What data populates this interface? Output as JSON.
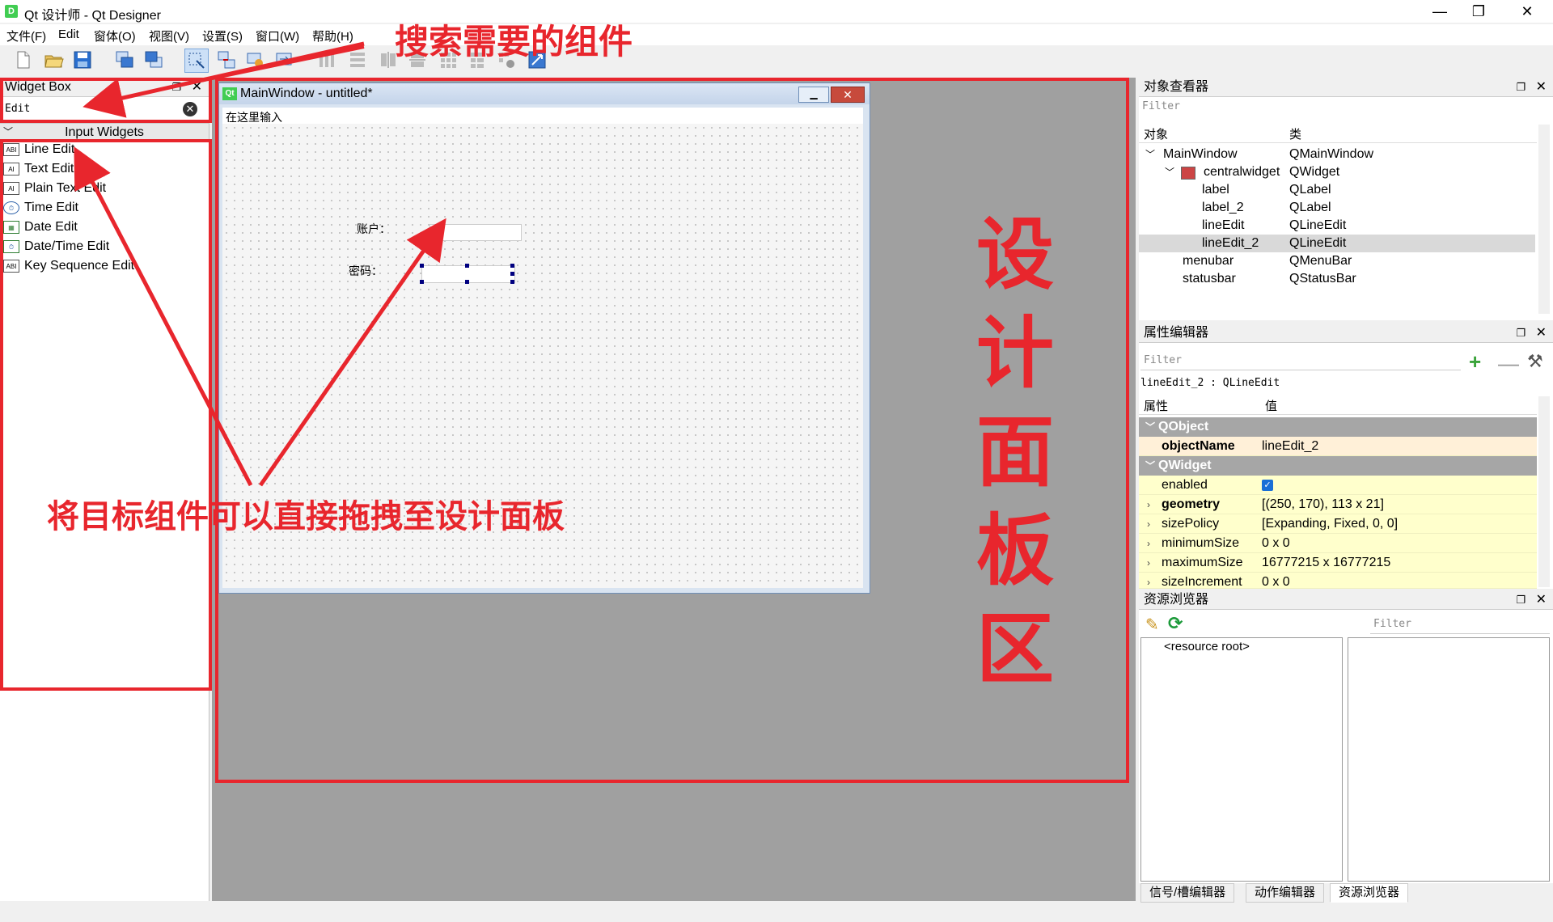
{
  "window": {
    "title": "Qt 设计师 - Qt Designer",
    "app_icon": "D",
    "min": "—",
    "max": "❐",
    "close": "✕"
  },
  "menubar": [
    "文件(F)",
    "Edit",
    "窗体(O)",
    "视图(V)",
    "设置(S)",
    "窗口(W)",
    "帮助(H)"
  ],
  "toolbar_icons": [
    "new-icon",
    "open-icon",
    "save-icon",
    "send-back-icon",
    "bring-front-icon",
    "edit-widgets-icon",
    "edit-signals-icon",
    "edit-buddies-icon",
    "edit-tab-order-icon",
    "layout-horizontal-icon",
    "layout-vertical-icon",
    "layout-splitter-h-icon",
    "layout-splitter-v-icon",
    "layout-grid-icon",
    "layout-form-icon",
    "break-layout-icon",
    "adjust-size-icon"
  ],
  "widget_box": {
    "title": "Widget Box",
    "search_value": "Edit",
    "category": "Input Widgets",
    "items": [
      "Line Edit",
      "Text Edit",
      "Plain Text Edit",
      "Time Edit",
      "Date Edit",
      "Date/Time Edit",
      "Key Sequence Edit"
    ],
    "item_icon_text": [
      "ABI",
      "AI",
      "AI",
      "⏱",
      "▦",
      "⏱",
      "ABI"
    ]
  },
  "form": {
    "title": "MainWindow - untitled*",
    "qt_icon": "Qt",
    "menu_placeholder": "在这里输入",
    "label_account": "账户：",
    "label_password": "密码："
  },
  "object_inspector": {
    "title": "对象查看器",
    "filter": "Filter",
    "col_object": "对象",
    "col_class": "类",
    "rows": [
      {
        "object": "MainWindow",
        "class": "QMainWindow"
      },
      {
        "object": "centralwidget",
        "class": "QWidget"
      },
      {
        "object": "label",
        "class": "QLabel"
      },
      {
        "object": "label_2",
        "class": "QLabel"
      },
      {
        "object": "lineEdit",
        "class": "QLineEdit"
      },
      {
        "object": "lineEdit_2",
        "class": "QLineEdit"
      },
      {
        "object": "menubar",
        "class": "QMenuBar"
      },
      {
        "object": "statusbar",
        "class": "QStatusBar"
      }
    ]
  },
  "property_editor": {
    "title": "属性编辑器",
    "filter": "Filter",
    "current": "lineEdit_2 : QLineEdit",
    "col_property": "属性",
    "col_value": "值",
    "group_qobject": "QObject",
    "group_qwidget": "QWidget",
    "object_name_label": "objectName",
    "object_name_value": "lineEdit_2",
    "enabled_label": "enabled",
    "enabled_checked": true,
    "props": [
      {
        "name": "geometry",
        "value": "[(250, 170), 113 x 21]"
      },
      {
        "name": "sizePolicy",
        "value": "[Expanding, Fixed, 0, 0]"
      },
      {
        "name": "minimumSize",
        "value": "0 x 0"
      },
      {
        "name": "maximumSize",
        "value": "16777215 x 16777215"
      },
      {
        "name": "sizeIncrement",
        "value": "0 x 0"
      }
    ]
  },
  "resource_browser": {
    "title": "资源浏览器",
    "filter": "Filter",
    "root": "<resource root>"
  },
  "bottom_tabs": [
    "信号/槽编辑器",
    "动作编辑器",
    "资源浏览器"
  ],
  "annotations": {
    "search": "搜索需要的组件",
    "drag": "将目标组件可以直接拖拽至设计面板",
    "design_chars": [
      "设",
      "计",
      "面",
      "板",
      "区"
    ],
    "color": "#e8262d"
  }
}
